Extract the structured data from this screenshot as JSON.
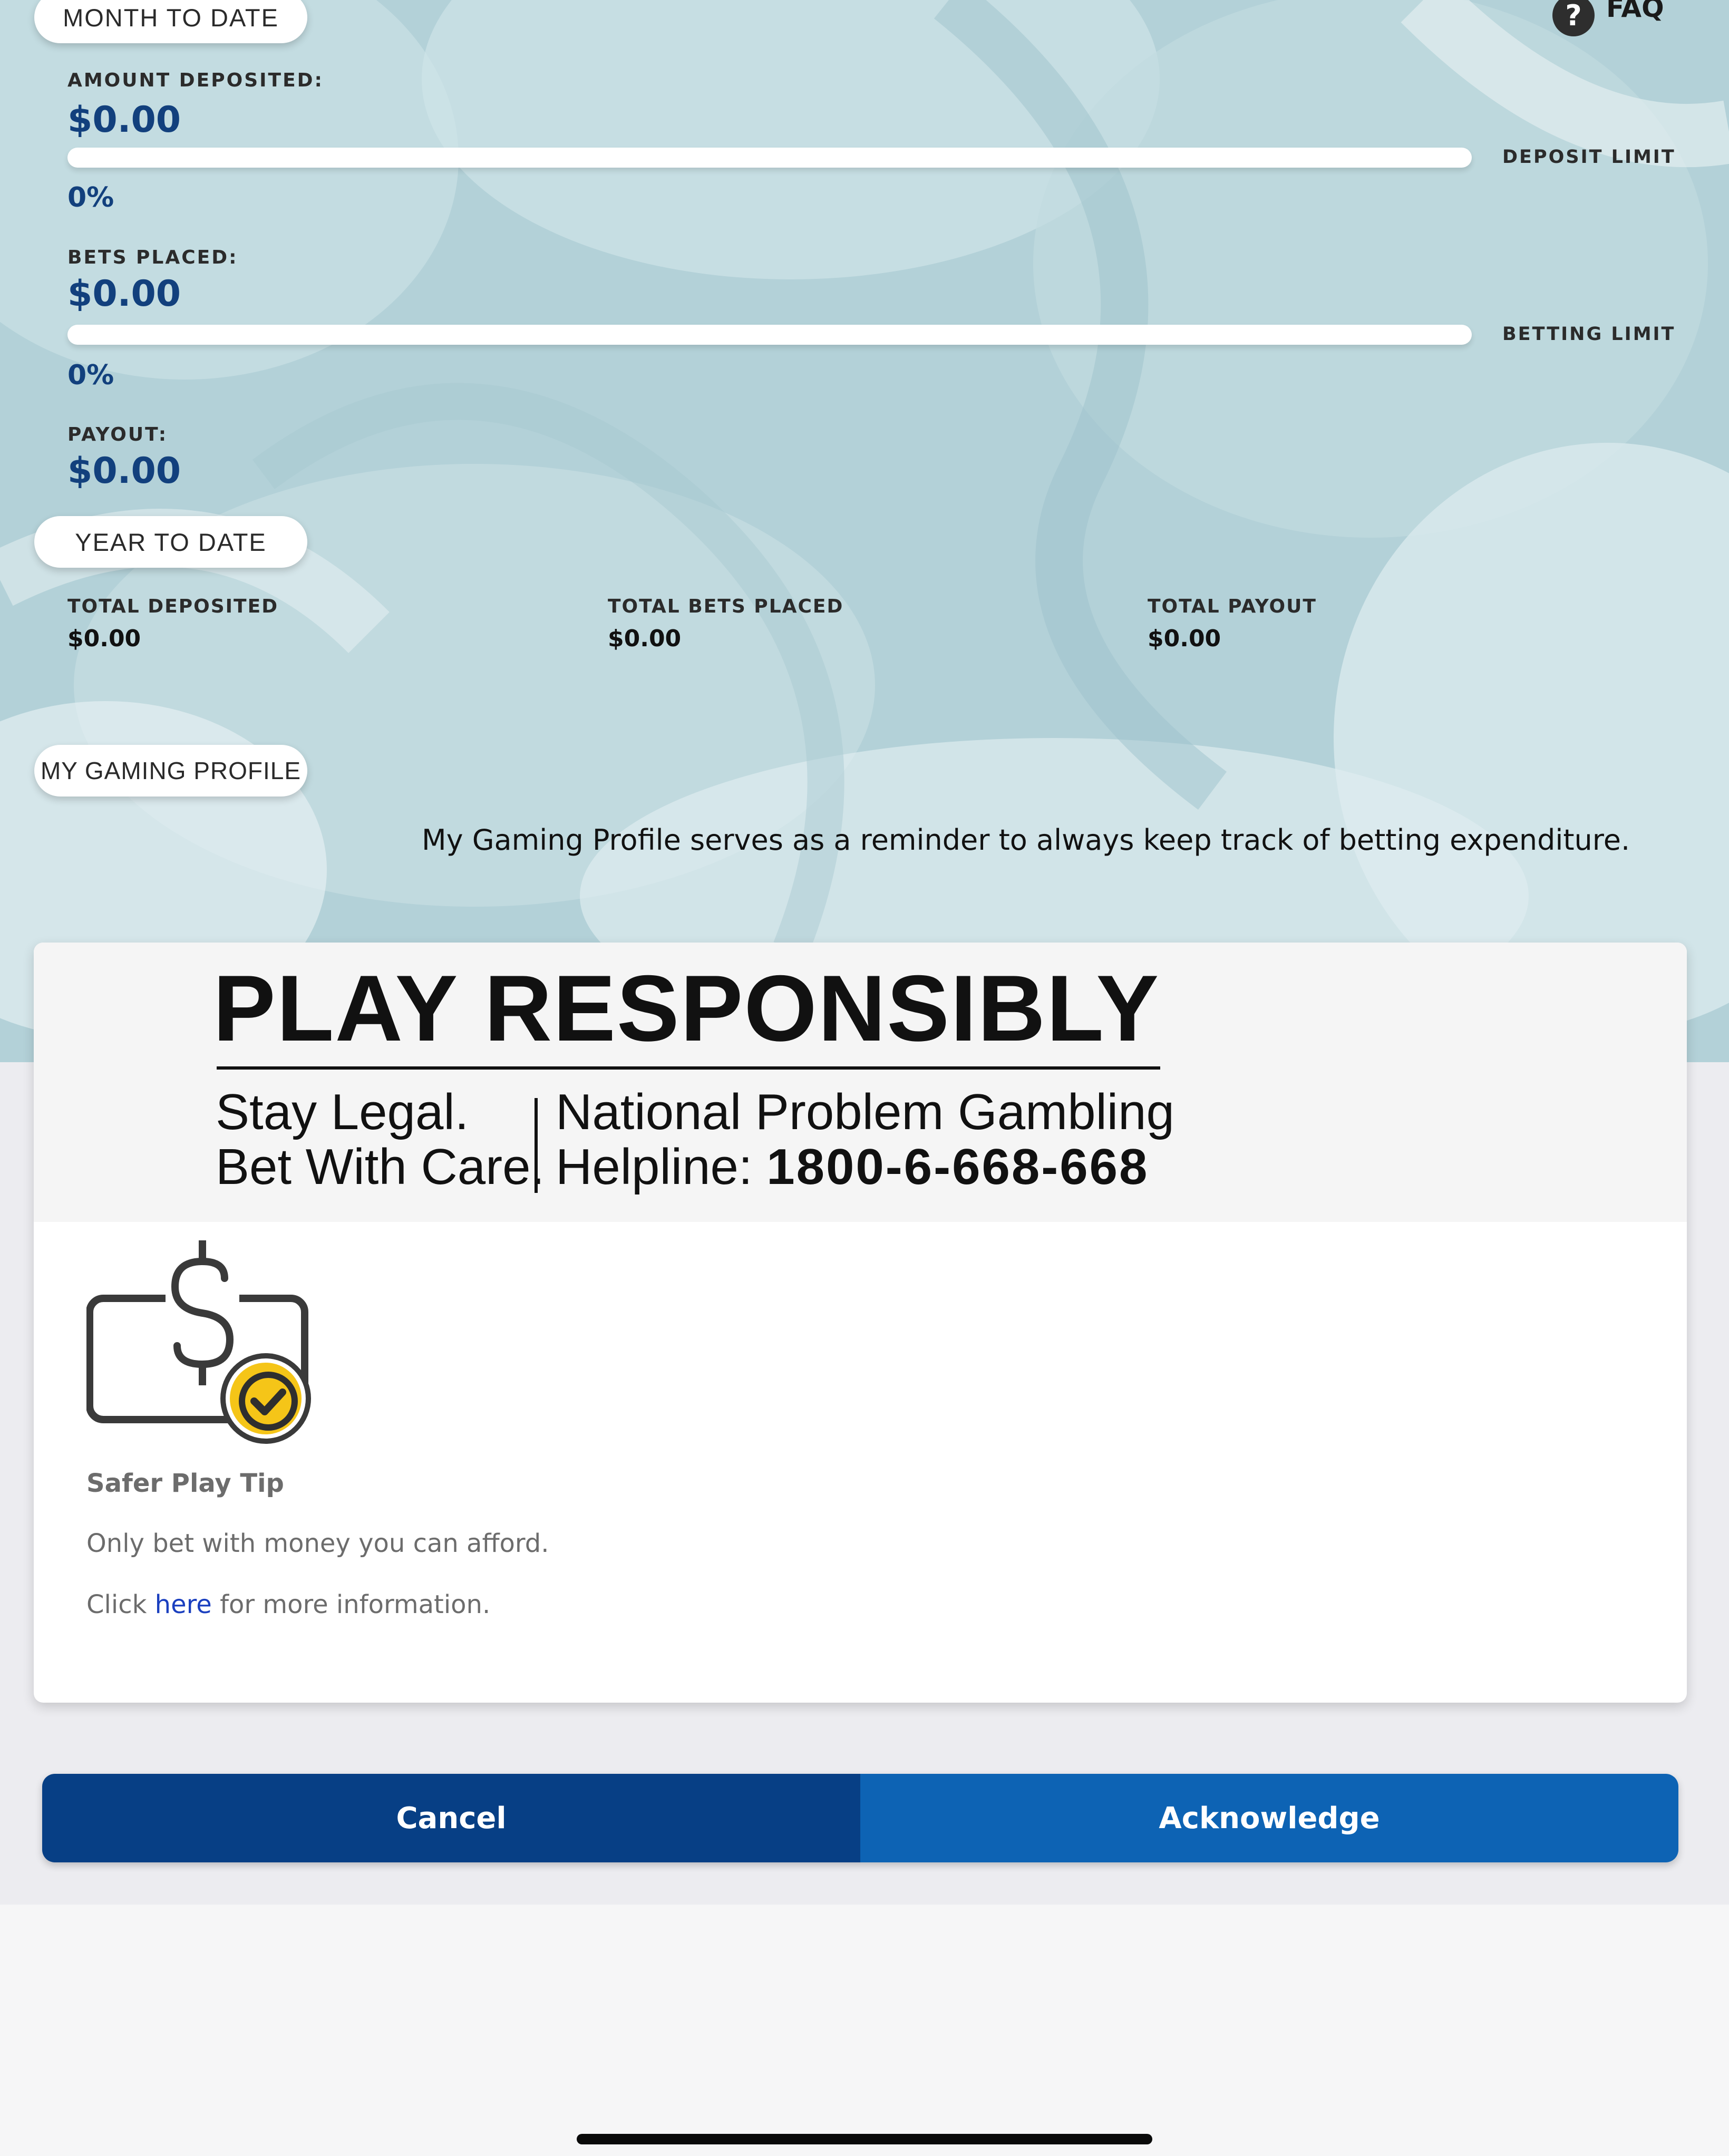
{
  "month_to_date": {
    "pill_label": "MONTH TO DATE",
    "amount_deposited_label": "AMOUNT DEPOSITED:",
    "amount_deposited_value": "$0.00",
    "deposit_progress_pct": "0%",
    "deposit_progress_value": 0,
    "deposit_limit_label": "DEPOSIT LIMIT",
    "bets_placed_label": "BETS PLACED:",
    "bets_placed_value": "$0.00",
    "betting_progress_pct": "0%",
    "betting_progress_value": 0,
    "betting_limit_label": "BETTING LIMIT",
    "payout_label": "PAYOUT:",
    "payout_value": "$0.00"
  },
  "faq": {
    "icon": "question-circle-icon",
    "icon_glyph": "?",
    "label": "FAQ"
  },
  "year_to_date": {
    "pill_label": "YEAR TO DATE",
    "totals": [
      {
        "label": "TOTAL DEPOSITED",
        "value": "$0.00"
      },
      {
        "label": "TOTAL BETS PLACED",
        "value": "$0.00"
      },
      {
        "label": "TOTAL PAYOUT",
        "value": "$0.00"
      }
    ]
  },
  "gaming_profile": {
    "pill_label": "MY GAMING PROFILE",
    "description": "My Gaming Profile serves as a reminder to always keep track of betting expenditure."
  },
  "banner": {
    "title": "PLAY RESPONSIBLY",
    "left_line1": "Stay Legal.",
    "left_line2": "Bet With Care.",
    "right_line1": "National Problem Gambling",
    "right_line2_prefix": "Helpline: ",
    "right_line2_number": "1800-6-668-668"
  },
  "tip": {
    "icon": "wallet-dollar-check-icon",
    "title": "Safer Play Tip",
    "text": "Only bet with money you can afford.",
    "link_prefix": "Click ",
    "link_text": "here",
    "link_suffix": " for more information."
  },
  "actions": {
    "cancel_label": "Cancel",
    "acknowledge_label": "Acknowledge"
  },
  "colors": {
    "accent_value": "#12407d",
    "cancel_bg": "#073f85",
    "acknowledge_bg": "#0d63b4",
    "hero_bg": "#b4d2d9",
    "tip_check": "#f5c518"
  }
}
